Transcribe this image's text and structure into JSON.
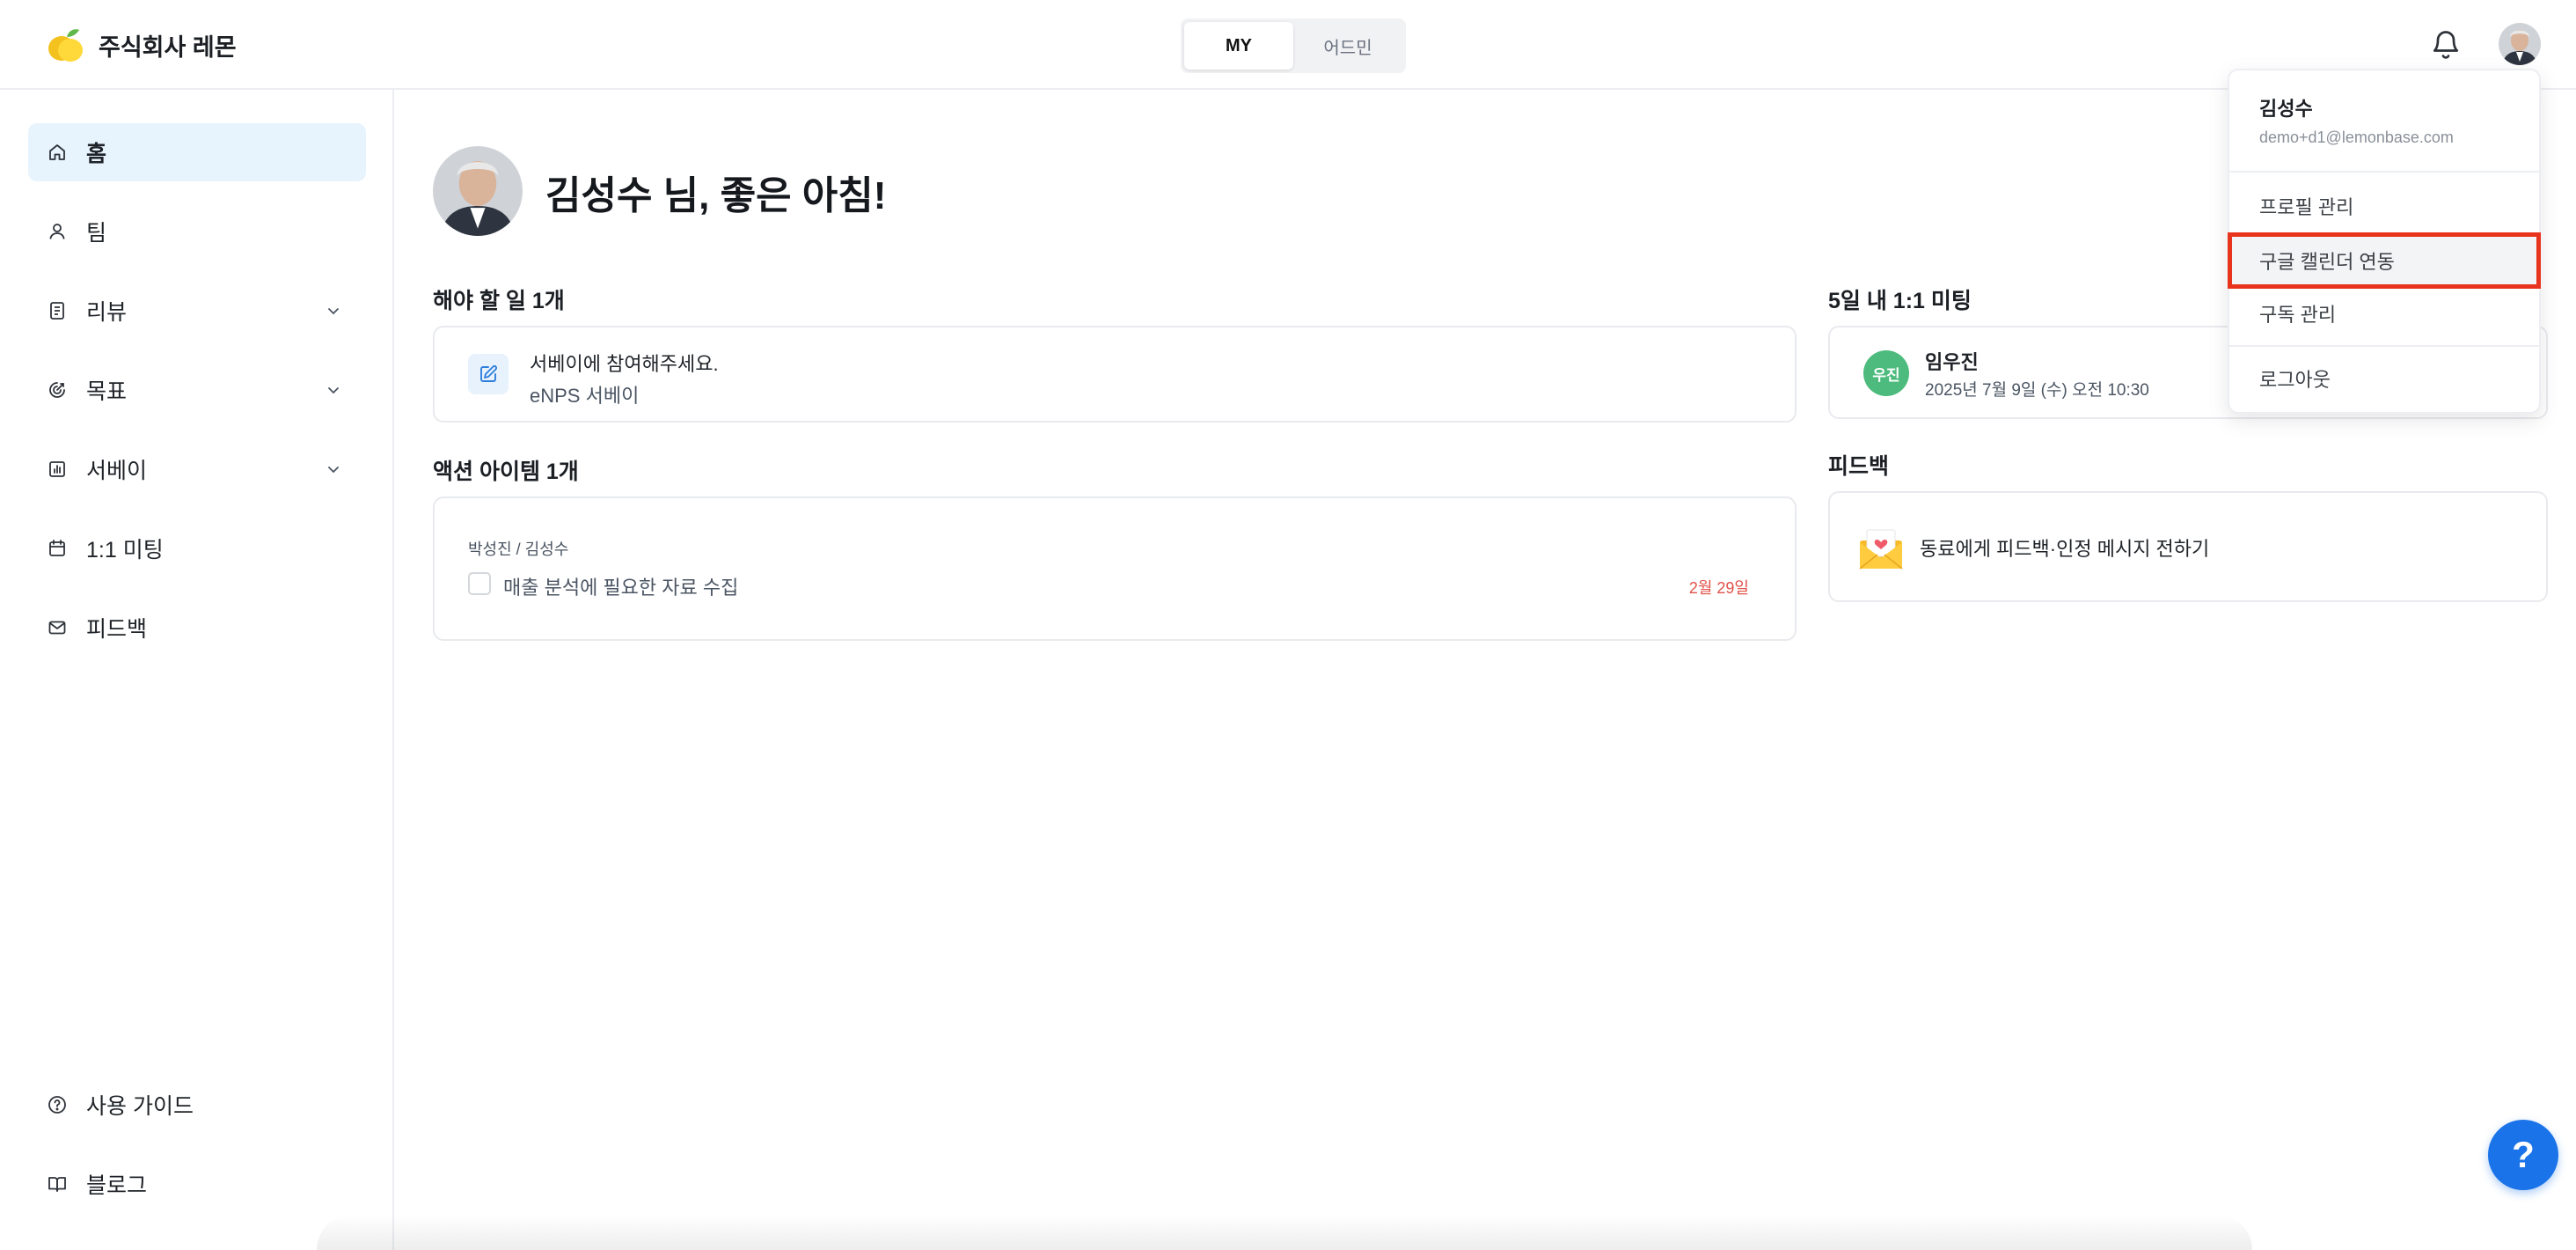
{
  "header": {
    "brand_name": "주식회사 레몬",
    "mode_tabs": [
      {
        "label": "MY",
        "active": true
      },
      {
        "label": "어드민",
        "active": false
      }
    ]
  },
  "sidebar": {
    "items": [
      {
        "label": "홈",
        "icon": "home-icon",
        "active": true,
        "expandable": false
      },
      {
        "label": "팀",
        "icon": "user-icon",
        "active": false,
        "expandable": false
      },
      {
        "label": "리뷰",
        "icon": "document-icon",
        "active": false,
        "expandable": true
      },
      {
        "label": "목표",
        "icon": "target-icon",
        "active": false,
        "expandable": true
      },
      {
        "label": "서베이",
        "icon": "bar-chart-icon",
        "active": false,
        "expandable": true
      },
      {
        "label": "1:1 미팅",
        "icon": "calendar-icon",
        "active": false,
        "expandable": false
      },
      {
        "label": "피드백",
        "icon": "mail-icon",
        "active": false,
        "expandable": false
      }
    ],
    "bottom_items": [
      {
        "label": "사용 가이드",
        "icon": "help-circle-icon"
      },
      {
        "label": "블로그",
        "icon": "book-icon"
      }
    ]
  },
  "main": {
    "greeting": "김성수 님, 좋은 아침!",
    "todo": {
      "title": "해야 할 일 1개",
      "item_title": "서베이에 참여해주세요.",
      "item_subtitle": "eNPS 서베이"
    },
    "actions": {
      "title": "액션 아이템 1개",
      "owners": "박성진 / 김성수",
      "item_text": "매출 분석에 필요한 자료 수집",
      "due_date": "2월 29일",
      "checked": false
    },
    "meetings": {
      "title": "5일 내 1:1 미팅",
      "avatar_text": "우진",
      "person": "임우진",
      "datetime": "2025년 7월 9일 (수) 오전 10:30"
    },
    "feedback": {
      "title": "피드백",
      "item_text": "동료에게 피드백·인정 메시지 전하기"
    }
  },
  "user_menu": {
    "name": "김성수",
    "email": "demo+d1@lemonbase.com",
    "items": [
      {
        "label": "프로필 관리"
      },
      {
        "label": "구글 캘린더 연동",
        "highlighted": true
      },
      {
        "label": "구독 관리"
      },
      {
        "label": "로그아웃"
      }
    ]
  },
  "help_button": {
    "label": "?"
  },
  "colors": {
    "accent_blue": "#1a73e8",
    "active_nav_bg": "#e8f4fd",
    "due_date_red": "#e0534a",
    "meeting_avatar_green": "#4cbb7d",
    "highlight_outline": "#e8341c"
  }
}
